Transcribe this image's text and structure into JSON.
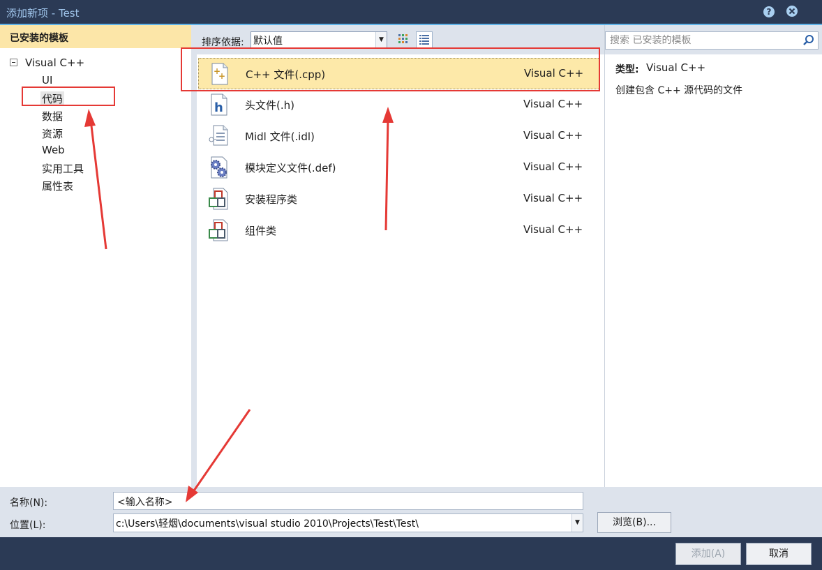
{
  "window": {
    "title": "添加新项 - Test"
  },
  "left": {
    "header": "已安装的模板",
    "root": "Visual C++",
    "children": [
      "UI",
      "代码",
      "数据",
      "资源",
      "Web",
      "实用工具",
      "属性表"
    ]
  },
  "middle": {
    "sort_label": "排序依据:",
    "sort_value": "默认值",
    "items": [
      {
        "name": "C++ 文件(.cpp)",
        "type": "Visual C++"
      },
      {
        "name": "头文件(.h)",
        "type": "Visual C++"
      },
      {
        "name": "Midl 文件(.idl)",
        "type": "Visual C++"
      },
      {
        "name": "模块定义文件(.def)",
        "type": "Visual C++"
      },
      {
        "name": "安装程序类",
        "type": "Visual C++"
      },
      {
        "name": "组件类",
        "type": "Visual C++"
      }
    ]
  },
  "right": {
    "search_placeholder": "搜索 已安装的模板",
    "type_label": "类型:",
    "type_value": "Visual C++",
    "description": "创建包含 C++ 源代码的文件"
  },
  "bottom": {
    "name_label": "名称(N):",
    "name_value": "<输入名称>",
    "location_label": "位置(L):",
    "location_value": "c:\\Users\\轻烟\\documents\\visual studio 2010\\Projects\\Test\\Test\\",
    "browse": "浏览(B)...",
    "add": "添加(A)",
    "cancel": "取消"
  },
  "colors": {
    "selection": "#fde9a9",
    "header": "#fce6a8",
    "titlebar": "#2b3a55",
    "annotation": "#e53935"
  }
}
